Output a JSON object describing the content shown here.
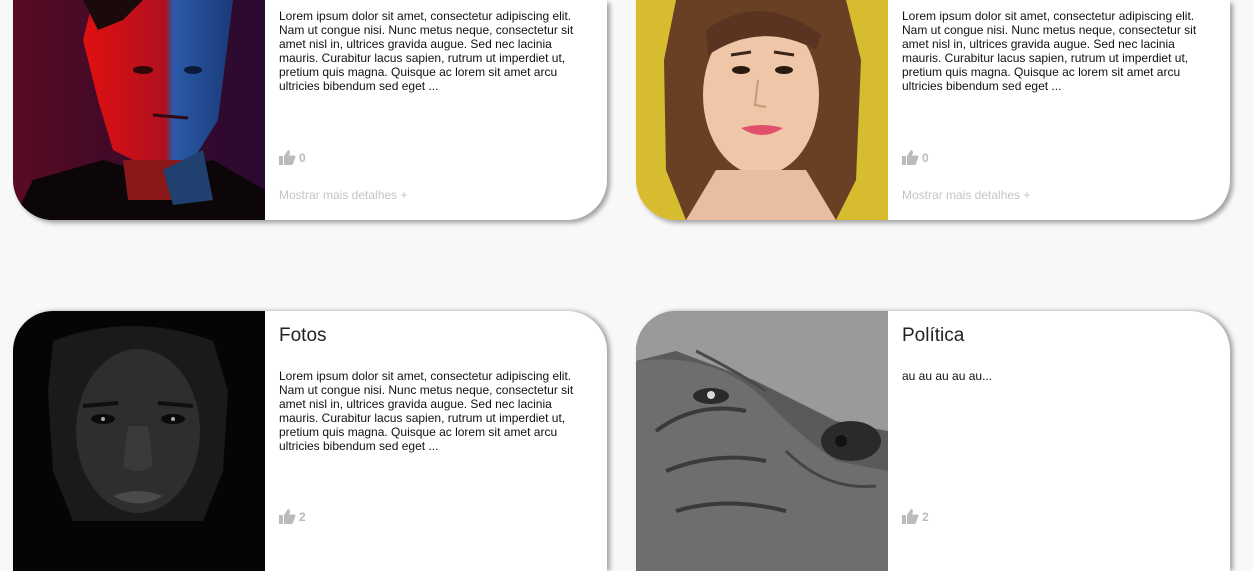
{
  "cards": [
    {
      "title": "",
      "text": "Lorem ipsum dolor sit amet, consectetur adipiscing elit. Nam ut congue nisi. Nunc metus neque, consectetur sit amet nisl in, ultrices gravida augue. Sed nec lacinia mauris. Curabitur lacus sapien, rutrum ut imperdiet ut, pretium quis magna. Quisque ac lorem sit amet arcu ultricies bibendum sed eget ...",
      "likes": "0",
      "more": "Mostrar mais detalhes +"
    },
    {
      "title": "",
      "text": "Lorem ipsum dolor sit amet, consectetur adipiscing elit. Nam ut congue nisi. Nunc metus neque, consectetur sit amet nisl in, ultrices gravida augue. Sed nec lacinia mauris. Curabitur lacus sapien, rutrum ut imperdiet ut, pretium quis magna. Quisque ac lorem sit amet arcu ultricies bibendum sed eget ...",
      "likes": "0",
      "more": "Mostrar mais detalhes +"
    },
    {
      "title": "Fotos",
      "text": "Lorem ipsum dolor sit amet, consectetur adipiscing elit. Nam ut congue nisi. Nunc metus neque, consectetur sit amet nisl in, ultrices gravida augue. Sed nec lacinia mauris. Curabitur lacus sapien, rutrum ut imperdiet ut, pretium quis magna. Quisque ac lorem sit amet arcu ultricies bibendum sed eget ...",
      "likes": "2",
      "more": ""
    },
    {
      "title": "Política",
      "text": "au au au au au...",
      "likes": "2",
      "more": ""
    }
  ],
  "colors": {
    "background": "#f8f8f8",
    "card": "#ffffff",
    "muted": "#c4c4c4"
  },
  "icons": {
    "like": "thumbs-up-icon"
  }
}
